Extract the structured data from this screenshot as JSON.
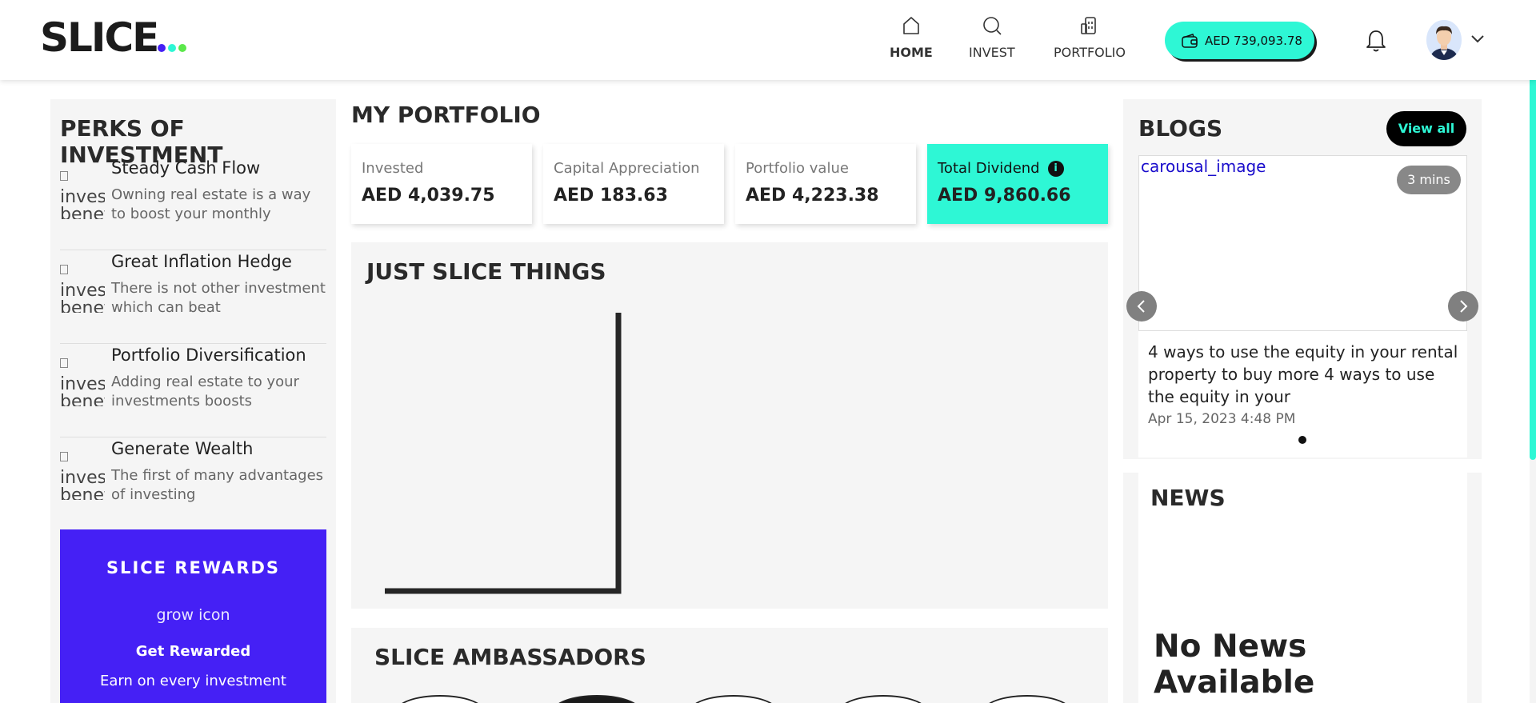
{
  "header": {
    "logo_text": "SLICE",
    "logo_dot_colors": [
      "#4520f5",
      "#2ef7d5",
      "#5be84b"
    ],
    "nav": [
      {
        "label": "HOME",
        "icon": "home-icon",
        "active": true
      },
      {
        "label": "INVEST",
        "icon": "search-icon",
        "active": false
      },
      {
        "label": "PORTFOLIO",
        "icon": "building-icon",
        "active": false
      }
    ],
    "wallet_balance": "AED 739,093.78",
    "accent_color": "#2ef7d5"
  },
  "perks": {
    "title": "PERKS OF INVESTMENT",
    "image_alt": "invest benef",
    "items": [
      {
        "title": "Steady Cash Flow",
        "description": "Owning real estate is a way to boost your monthly"
      },
      {
        "title": "Great Inflation Hedge",
        "description": "There is not other investment which can beat"
      },
      {
        "title": "Portfolio Diversification",
        "description": "Adding real estate to your investments boosts"
      },
      {
        "title": "Generate Wealth",
        "description": "The first of many advantages of investing"
      }
    ],
    "rewards": {
      "title": "SLICE REWARDS",
      "icon_alt": "grow icon",
      "heading": "Get Rewarded",
      "subtext": "Earn on every investment",
      "color": "#4520f5"
    }
  },
  "portfolio": {
    "title": "MY PORTFOLIO",
    "cards": [
      {
        "label": "Invested",
        "value": "AED 4,039.75"
      },
      {
        "label": "Capital Appreciation",
        "value": "AED 183.63"
      },
      {
        "label": "Portfolio value",
        "value": "AED 4,223.38"
      },
      {
        "label": "Total Dividend",
        "value": "AED 9,860.66",
        "info_icon": "i"
      }
    ]
  },
  "things": {
    "title": "JUST SLICE THINGS"
  },
  "ambassadors": {
    "title": "SLICE AMBASSADORS"
  },
  "blogs": {
    "title": "BLOGS",
    "view_all": "View all",
    "post": {
      "image_alt": "carousal_image",
      "read_time": "3 mins",
      "text": "4 ways to use the equity in your rental property to buy more 4 ways to use the equity in your",
      "date": "Apr 15, 2023 4:48 PM"
    }
  },
  "news": {
    "title": "NEWS",
    "empty_text": "No News Available"
  }
}
